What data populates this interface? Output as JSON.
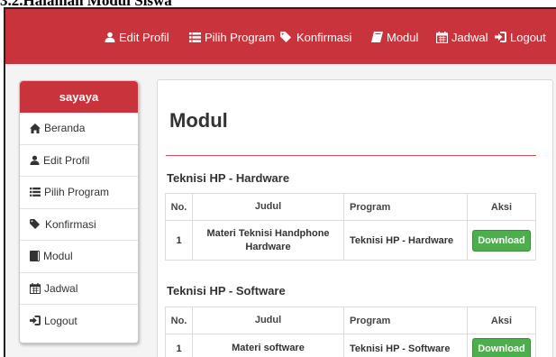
{
  "caption": "3.2.Halaman Modul Siswa",
  "navbar": {
    "items": [
      {
        "label": "Edit Profil",
        "icon": "user-icon"
      },
      {
        "label": "Pilih Program",
        "icon": "list-icon"
      },
      {
        "label": "Konfirmasi",
        "icon": "tag-icon"
      },
      {
        "label": "Modul",
        "icon": "book-icon"
      },
      {
        "label": "Jadwal",
        "icon": "calendar-icon"
      },
      {
        "label": "Logout",
        "icon": "logout-icon"
      }
    ]
  },
  "sidebar": {
    "username": "sayaya",
    "items": [
      {
        "label": "Beranda",
        "icon": "home-icon"
      },
      {
        "label": "Edit Profil",
        "icon": "user-icon"
      },
      {
        "label": "Pilih Program",
        "icon": "list-icon"
      },
      {
        "label": "Konfirmasi",
        "icon": "tag-icon"
      },
      {
        "label": "Modul",
        "icon": "book-icon"
      },
      {
        "label": "Jadwal",
        "icon": "calendar-icon"
      },
      {
        "label": "Logout",
        "icon": "logout-icon"
      }
    ]
  },
  "main": {
    "title": "Modul",
    "table_headers": [
      "No.",
      "Judul",
      "Program",
      "Aksi"
    ],
    "sections": [
      {
        "title": "Teknisi HP - Hardware",
        "rows": [
          {
            "no": "1",
            "judul": "Materi Teknisi Handphone Hardware",
            "program": "Teknisi HP - Hardware",
            "aksi": "Download"
          }
        ]
      },
      {
        "title": "Teknisi HP - Software",
        "rows": [
          {
            "no": "1",
            "judul": "Materi software",
            "program": "Teknisi HP - Software",
            "aksi": "Download"
          }
        ]
      }
    ]
  },
  "colors": {
    "brand_red": "#c9343c",
    "download_green": "#4cae4c"
  }
}
